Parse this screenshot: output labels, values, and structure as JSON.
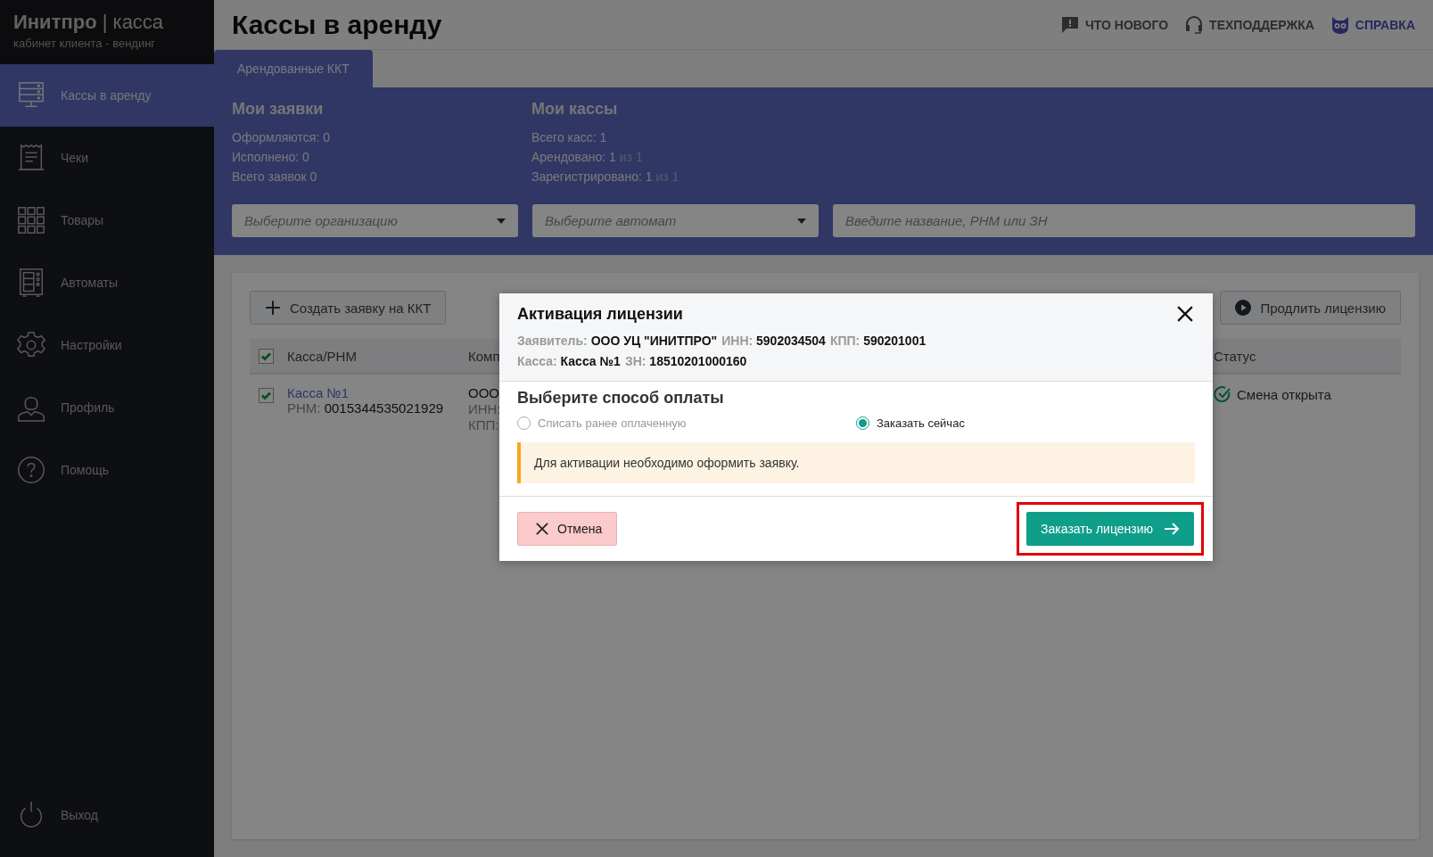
{
  "app": {
    "brand": "Инитпро",
    "separator": "|",
    "product": "касса",
    "subtitle": "кабинет клиента - вендинг"
  },
  "sidebar": {
    "items": [
      {
        "label": "Кассы в аренду",
        "selected": true
      },
      {
        "label": "Чеки",
        "selected": false
      },
      {
        "label": "Товары",
        "selected": false
      },
      {
        "label": "Автоматы",
        "selected": false
      },
      {
        "label": "Настройки",
        "selected": false
      },
      {
        "label": "Профиль",
        "selected": false
      },
      {
        "label": "Помощь",
        "selected": false
      }
    ],
    "logout": "Выход"
  },
  "header": {
    "title": "Кассы в аренду",
    "links": [
      {
        "label": "ЧТО НОВОГО",
        "accent": false
      },
      {
        "label": "ТЕХПОДДЕРЖКА",
        "accent": false
      },
      {
        "label": "СПРАВКА",
        "accent": true
      }
    ]
  },
  "tabs": [
    {
      "label": "Арендованные ККТ",
      "selected": true
    }
  ],
  "summary": [
    {
      "title": "Мои заявки",
      "lines": [
        {
          "label": "Оформляются:",
          "value": "0"
        },
        {
          "label": "Исполнено:",
          "value": "0"
        },
        {
          "label": "Всего заявок",
          "value": "0"
        }
      ]
    },
    {
      "title": "Мои кассы",
      "lines": [
        {
          "label": "Всего касс:",
          "value": "1"
        },
        {
          "label": "Арендовано:",
          "value": "1",
          "suffix": "из 1"
        },
        {
          "label": "Зарегистрировано:",
          "value": "1",
          "suffix": "из 1"
        }
      ]
    }
  ],
  "filters": {
    "organization": {
      "placeholder": "Выберите организацию"
    },
    "machine": {
      "placeholder": "Выберите автомат"
    },
    "search": {
      "placeholder": "Введите название, РНМ или ЗН"
    }
  },
  "toolbar": {
    "create": "Создать заявку на ККТ",
    "extend": "Продлить лицензию"
  },
  "table": {
    "all_checked": true,
    "columns": [
      "Касса/РНМ",
      "Комп",
      "Статус"
    ],
    "rows": [
      {
        "checked": true,
        "name": "Касса №1",
        "rnm_label": "РНМ:",
        "rnm": "0015344535021929",
        "company": [
          "ООО",
          "ИНН:",
          "КПП:"
        ],
        "status": "Смена открыта"
      }
    ]
  },
  "modal": {
    "title": "Активация лицензии",
    "details": [
      [
        {
          "label": "Заявитель:",
          "value": "ООО УЦ \"ИНИТПРО\""
        },
        {
          "label": "ИНН:",
          "value": "5902034504"
        },
        {
          "label": "КПП:",
          "value": "590201001"
        }
      ],
      [
        {
          "label": "Касса:",
          "value": "Касса №1"
        },
        {
          "label": "ЗН:",
          "value": "18510201000160"
        }
      ]
    ],
    "section_title": "Выберите способ оплаты",
    "options": [
      {
        "label": "Списать ранее оплаченную",
        "selected": false
      },
      {
        "label": "Заказать сейчас",
        "selected": true
      }
    ],
    "notice": "Для активации необходимо оформить заявку.",
    "cancel": "Отмена",
    "submit": "Заказать лицензию",
    "submit_highlighted": true
  }
}
